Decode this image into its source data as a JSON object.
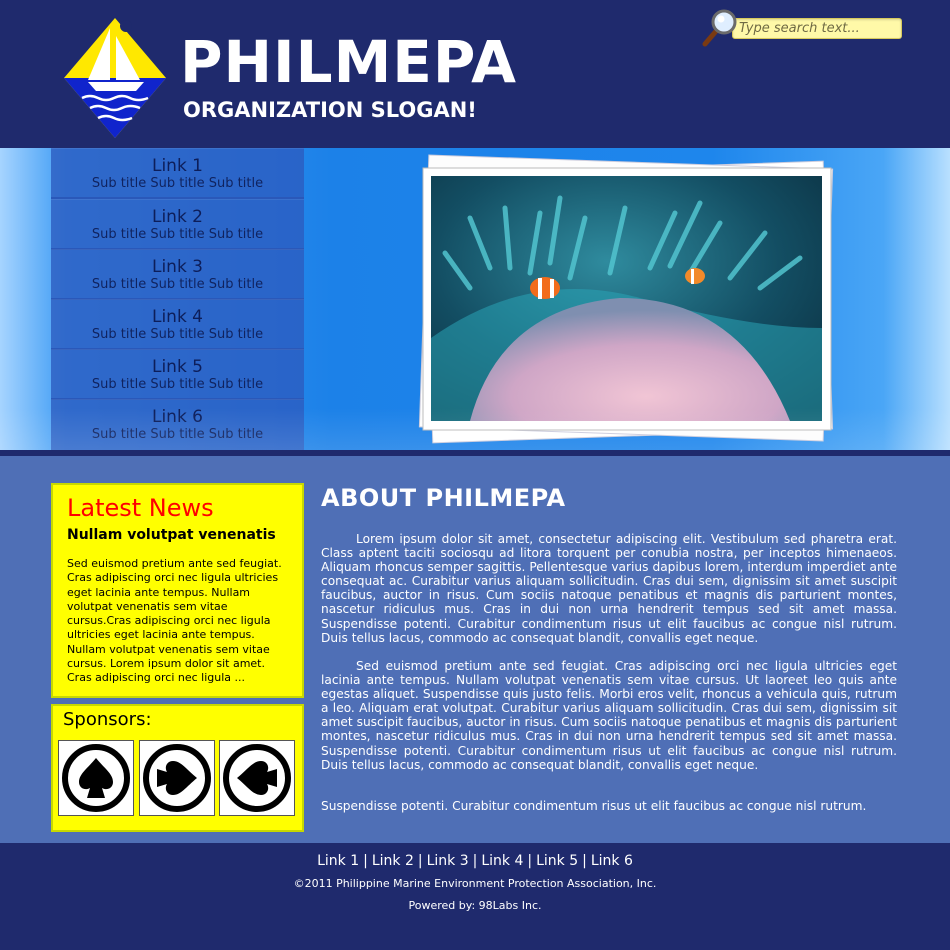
{
  "header": {
    "title": "PHILMEPA",
    "slogan": "ORGANIZATION SLOGAN!",
    "search_placeholder": "Type search text..."
  },
  "nav": {
    "items": [
      {
        "label": "Link 1",
        "sub": "Sub title Sub title Sub title"
      },
      {
        "label": "Link 2",
        "sub": "Sub title Sub title Sub title"
      },
      {
        "label": "Link 3",
        "sub": "Sub title Sub title Sub title"
      },
      {
        "label": "Link 4",
        "sub": "Sub title Sub title Sub title"
      },
      {
        "label": "Link 5",
        "sub": "Sub title Sub title Sub title"
      },
      {
        "label": "Link 6",
        "sub": "Sub title Sub title Sub title"
      }
    ]
  },
  "news": {
    "title": "Latest News",
    "headline": "Nullam volutpat venenatis",
    "body": "Sed euismod pretium ante sed feugiat. Cras adipiscing orci nec ligula ultricies eget lacinia ante tempus. Nullam volutpat venenatis sem vitae cursus.Cras adipiscing orci nec ligula ultricies eget lacinia ante tempus. Nullam volutpat venenatis sem vitae cursus. Lorem ipsum dolor sit amet. Cras adipiscing orci nec ligula ..."
  },
  "sponsors": {
    "title": "Sponsors:",
    "icons": [
      "spade-up-icon",
      "spade-right-icon",
      "spade-left-icon"
    ]
  },
  "about": {
    "title": "ABOUT PHILMEPA",
    "p1": "Lorem ipsum dolor sit amet, consectetur adipiscing elit. Vestibulum sed pharetra erat. Class aptent taciti sociosqu ad litora torquent per conubia nostra, per inceptos himenaeos. Aliquam rhoncus semper sagittis. Pellentesque varius dapibus lorem, interdum imperdiet ante consequat ac. Curabitur varius aliquam sollicitudin. Cras dui sem, dignissim sit amet suscipit faucibus, auctor in risus. Cum sociis natoque penatibus et magnis dis parturient montes, nascetur ridiculus mus. Cras in dui non urna hendrerit tempus sed sit amet massa. Suspendisse potenti. Curabitur condimentum risus ut elit faucibus ac congue nisl rutrum. Duis tellus lacus, commodo ac consequat blandit, convallis eget neque.",
    "p2": "Sed euismod pretium ante sed feugiat. Cras adipiscing orci nec ligula ultricies eget lacinia ante tempus. Nullam volutpat venenatis sem vitae cursus. Ut laoreet leo quis ante egestas aliquet. Suspendisse quis justo felis. Morbi eros velit, rhoncus a vehicula quis, rutrum a leo. Aliquam erat volutpat. Curabitur varius aliquam sollicitudin. Cras dui sem, dignissim sit amet suscipit faucibus, auctor in risus. Cum sociis natoque penatibus et magnis dis parturient montes, nascetur ridiculus mus. Cras in dui non urna hendrerit tempus sed sit amet massa. Suspendisse potenti. Curabitur condimentum risus ut elit faucibus ac congue nisl rutrum. Duis tellus lacus, commodo ac consequat blandit, convallis eget neque.",
    "p3": "Suspendisse potenti. Curabitur condimentum risus ut elit faucibus ac congue nisl rutrum."
  },
  "footer": {
    "links": [
      "Link 1",
      "Link 2",
      "Link 3",
      "Link 4",
      "Link 5",
      "Link 6"
    ],
    "separator": "|",
    "copyright": "©2011 Philippine Marine Environment Protection Association, Inc.",
    "powered": "Powered by: 98Labs Inc."
  },
  "colors": {
    "header_bg": "#1f2a6d",
    "content_bg": "#4f6fb6",
    "news_bg": "#ffff00",
    "news_title": "#ff0000",
    "logo_yellow": "#ffe800",
    "logo_blue": "#1020c8"
  }
}
